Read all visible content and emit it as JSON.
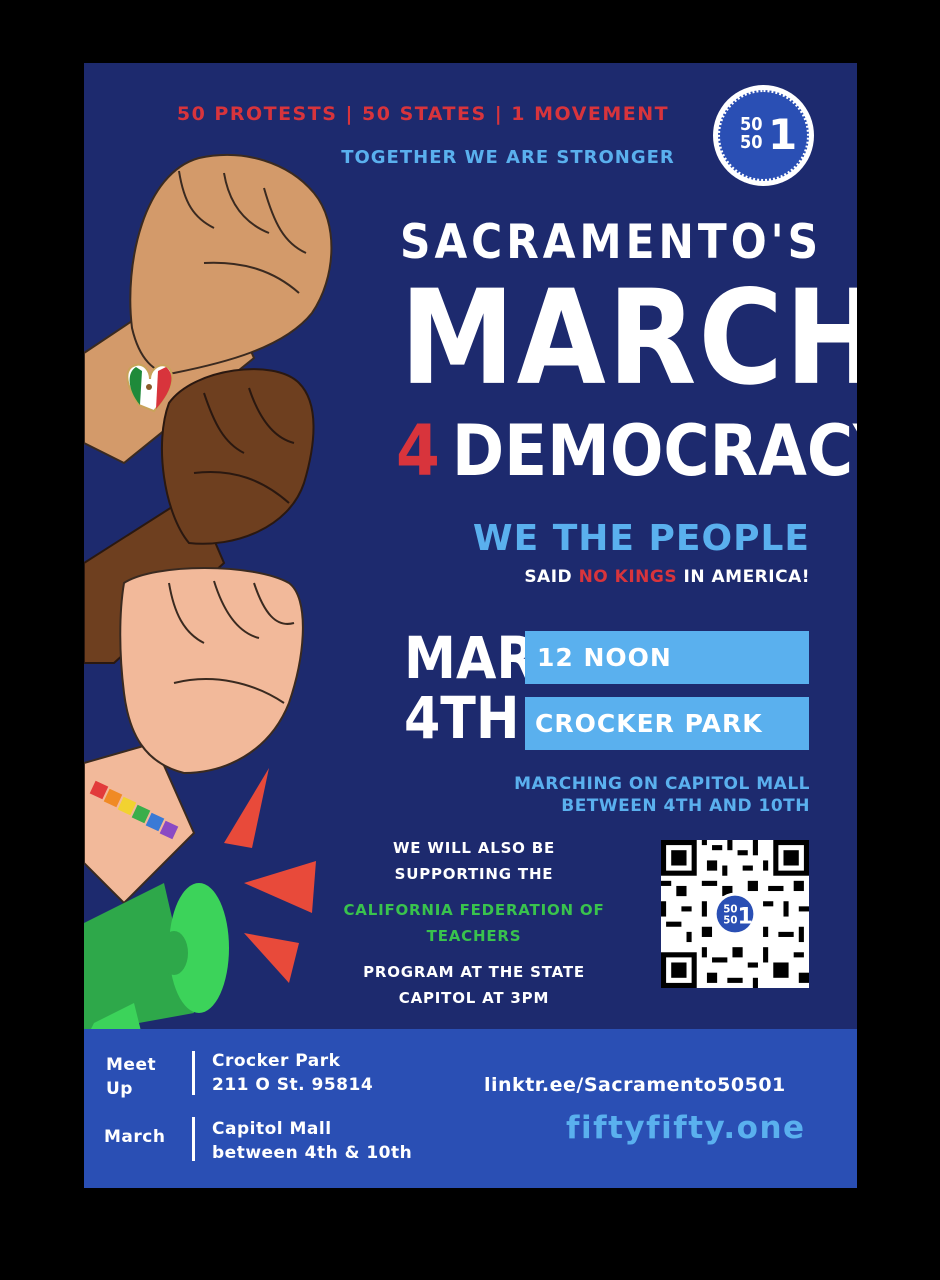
{
  "header": {
    "tagline": "50 PROTESTS | 50 STATES | 1 MOVEMENT",
    "subtagline": "TOGETHER WE ARE STRONGER"
  },
  "logo": {
    "top": "50",
    "bottom": "50",
    "one": "1"
  },
  "title": {
    "line1": "SACRAMENTO'S",
    "line2": "MARCH",
    "line3_num": "4",
    "line3_word": "DEMOCRACY"
  },
  "slogan": {
    "main": "WE THE PEOPLE",
    "sub_pre": "SAID ",
    "sub_red": "NO KINGS",
    "sub_post": " IN AMERICA!"
  },
  "event": {
    "date_line1": "MAR",
    "date_line2": "4TH",
    "time": "12 NOON",
    "place": "CROCKER PARK",
    "route_line1": "MARCHING ON CAPITOL MALL",
    "route_line2": "BETWEEN 4TH AND 10TH"
  },
  "support": {
    "line1": "WE WILL ALSO BE",
    "line2": "SUPPORTING THE",
    "org_line1": "CALIFORNIA FEDERATION OF",
    "org_line2": "TEACHERS",
    "line3": "PROGRAM AT THE STATE",
    "line4": "CAPITOL AT 3PM"
  },
  "footer": {
    "meet_label_1": "Meet",
    "meet_label_2": "Up",
    "meet_value_1": "Crocker Park",
    "meet_value_2": "211 O St. 95814",
    "march_label": "March",
    "march_value_1": "Capitol Mall",
    "march_value_2": "between 4th & 10th",
    "link": "linktr.ee/Sacramento50501",
    "site": "fiftyfifty.one"
  },
  "colors": {
    "background": "#1d2a6e",
    "red": "#d8343c",
    "light_blue": "#5ab0ee",
    "green": "#39c34d",
    "footer": "#2a4fb4"
  }
}
